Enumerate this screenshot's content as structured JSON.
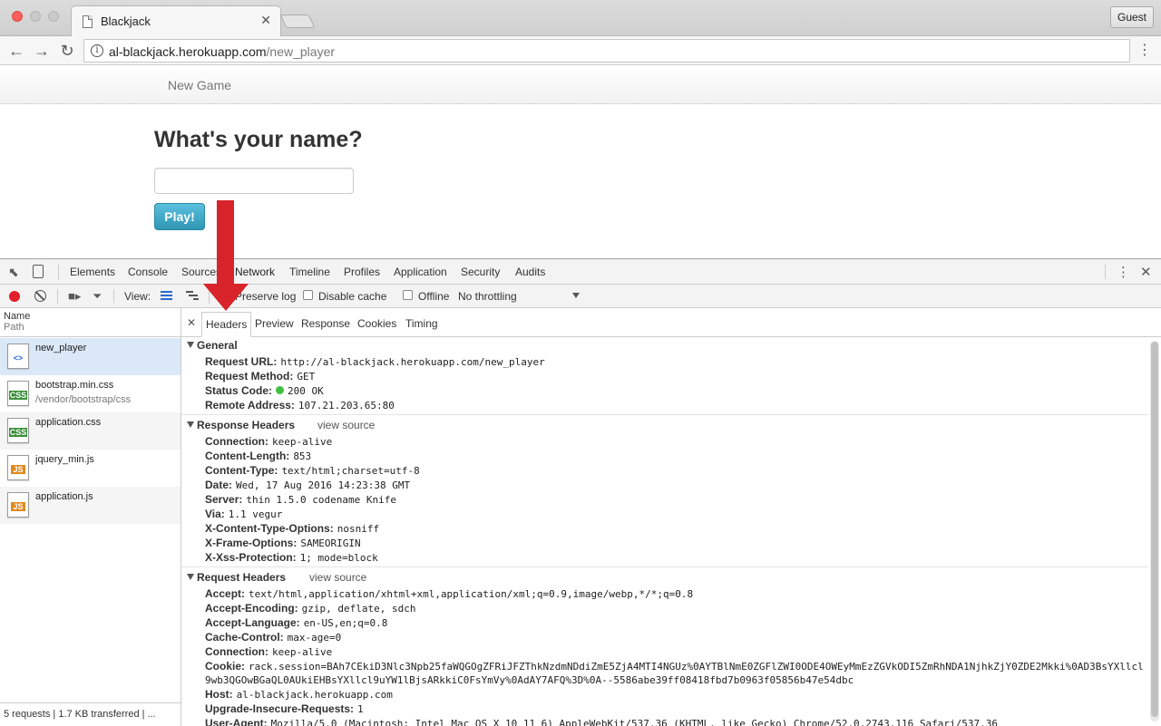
{
  "browser": {
    "tab_title": "Blackjack",
    "profile_button": "Guest",
    "url_host": "al-blackjack.herokuapp.com",
    "url_path": "/new_player"
  },
  "page": {
    "nav_link": "New Game",
    "heading": "What's your name?",
    "name_input_value": "",
    "play_button": "Play!"
  },
  "devtools": {
    "panels": [
      "Elements",
      "Console",
      "Sources",
      "Network",
      "Timeline",
      "Profiles",
      "Application",
      "Security",
      "Audits"
    ],
    "active_panel": "Network",
    "filter_bar": {
      "view_label": "View:",
      "preserve_log": "Preserve log",
      "disable_cache": "Disable cache",
      "offline": "Offline",
      "throttling": "No throttling"
    },
    "request_list": {
      "col_name": "Name",
      "col_path": "Path",
      "requests": [
        {
          "name": "new_player",
          "path": "",
          "type": "html-icon"
        },
        {
          "name": "bootstrap.min.css",
          "path": "/vendor/bootstrap/css",
          "type": "css-icon"
        },
        {
          "name": "application.css",
          "path": "",
          "type": "css-icon"
        },
        {
          "name": "jquery_min.js",
          "path": "",
          "type": "js-icon"
        },
        {
          "name": "application.js",
          "path": "",
          "type": "js-icon"
        }
      ],
      "footer": "5 requests  |  1.7 KB transferred  |  ..."
    },
    "detail_tabs": [
      "Headers",
      "Preview",
      "Response",
      "Cookies",
      "Timing"
    ],
    "active_detail_tab": "Headers",
    "general": {
      "title": "General",
      "rows": [
        {
          "k": "Request URL:",
          "v": "http://al-blackjack.herokuapp.com/new_player"
        },
        {
          "k": "Request Method:",
          "v": "GET"
        },
        {
          "k": "Status Code:",
          "v": "200 OK"
        },
        {
          "k": "Remote Address:",
          "v": "107.21.203.65:80"
        }
      ]
    },
    "response_headers": {
      "title": "Response Headers",
      "view_source": "view source",
      "rows": [
        {
          "k": "Connection:",
          "v": "keep-alive"
        },
        {
          "k": "Content-Length:",
          "v": "853"
        },
        {
          "k": "Content-Type:",
          "v": "text/html;charset=utf-8"
        },
        {
          "k": "Date:",
          "v": "Wed, 17 Aug 2016 14:23:38 GMT"
        },
        {
          "k": "Server:",
          "v": "thin 1.5.0 codename Knife"
        },
        {
          "k": "Via:",
          "v": "1.1 vegur"
        },
        {
          "k": "X-Content-Type-Options:",
          "v": "nosniff"
        },
        {
          "k": "X-Frame-Options:",
          "v": "SAMEORIGIN"
        },
        {
          "k": "X-Xss-Protection:",
          "v": "1; mode=block"
        }
      ]
    },
    "request_headers": {
      "title": "Request Headers",
      "view_source": "view source",
      "rows": [
        {
          "k": "Accept:",
          "v": "text/html,application/xhtml+xml,application/xml;q=0.9,image/webp,*/*;q=0.8"
        },
        {
          "k": "Accept-Encoding:",
          "v": "gzip, deflate, sdch"
        },
        {
          "k": "Accept-Language:",
          "v": "en-US,en;q=0.8"
        },
        {
          "k": "Cache-Control:",
          "v": "max-age=0"
        },
        {
          "k": "Connection:",
          "v": "keep-alive"
        }
      ],
      "cookie_key": "Cookie:",
      "cookie_value": "rack.session=BAh7CEkiD3Nlc3Npb25faWQGOgZFRiJFZThkNzdmNDdiZmE5ZjA4MTI4NGUz%0AYTBlNmE0ZGFlZWI0ODE4OWEyMmEzZGVkODI5ZmRhNDA1NjhkZjY0ZDE2Mkki%0AD3BsYXllcl9wb3QGOwBGaQL0AUkiEHBsYXllcl9uYW1lBjsARkkiC0FsYmVy%0AdAY7AFQ%3D%0A--5586abe39ff08418fbd7b0963f05856b47e54dbc",
      "rows_after": [
        {
          "k": "Host:",
          "v": "al-blackjack.herokuapp.com"
        },
        {
          "k": "Upgrade-Insecure-Requests:",
          "v": "1"
        },
        {
          "k": "User-Agent:",
          "v": "Mozilla/5.0 (Macintosh; Intel Mac OS X 10_11_6) AppleWebKit/537.36 (KHTML, like Gecko) Chrome/52.0.2743.116 Safari/537.36"
        }
      ]
    }
  },
  "colors": {
    "annotation_arrow": "#d8232a",
    "play_button": "#5bc0de",
    "status_ok": "#3fbf3f",
    "record_button": "#e0202a"
  }
}
